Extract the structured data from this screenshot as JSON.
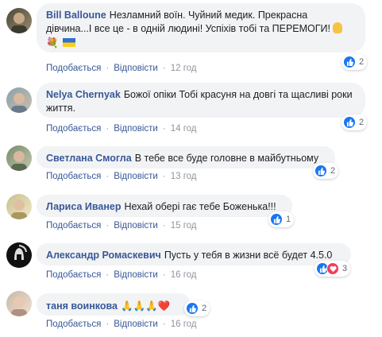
{
  "actions": {
    "like": "Подобається",
    "reply": "Відповісти",
    "separator": "·"
  },
  "comments": [
    {
      "author": "Bill Balloune",
      "text": "Незламний воїн. Чуйний медик. Прекрасна дівчина...І все це - в одній людині! Успіхів тобі та ПЕРЕМОГИ!",
      "emoji_line": "💐",
      "time": "12 год",
      "reactions": {
        "count": "2",
        "types": [
          "like"
        ]
      }
    },
    {
      "author": "Nelya Chernyak",
      "text": "Божої опіки Тобі красуня на довгі та щасливі роки життя.",
      "time": "14 год",
      "reactions": {
        "count": "2",
        "types": [
          "like"
        ]
      }
    },
    {
      "author": "Светлана Смогла",
      "text": "В тебе все буде головне в майбутньому",
      "time": "13 год",
      "reactions": {
        "count": "2",
        "types": [
          "like"
        ]
      }
    },
    {
      "author": "Лариса Иванер",
      "text": "Нехай обері гає тебе Боженька!!!",
      "time": "15 год",
      "reactions": {
        "count": "1",
        "types": [
          "like"
        ]
      }
    },
    {
      "author": "Александр Ромаскевич",
      "text": "Пусть у тебя в жизни всё будет 4.5.0",
      "time": "16 год",
      "reactions": {
        "count": "3",
        "types": [
          "like",
          "love"
        ]
      }
    },
    {
      "author": "таня воинкова",
      "text": "🙏🙏🙏❤️",
      "time": "16 год",
      "reactions": {
        "count": "2",
        "types": [
          "like"
        ]
      }
    }
  ],
  "colors": {
    "link": "#385898",
    "bubble": "#f2f3f5",
    "muted": "#90949c",
    "like": "#1877f2",
    "love": "#f33e58"
  }
}
